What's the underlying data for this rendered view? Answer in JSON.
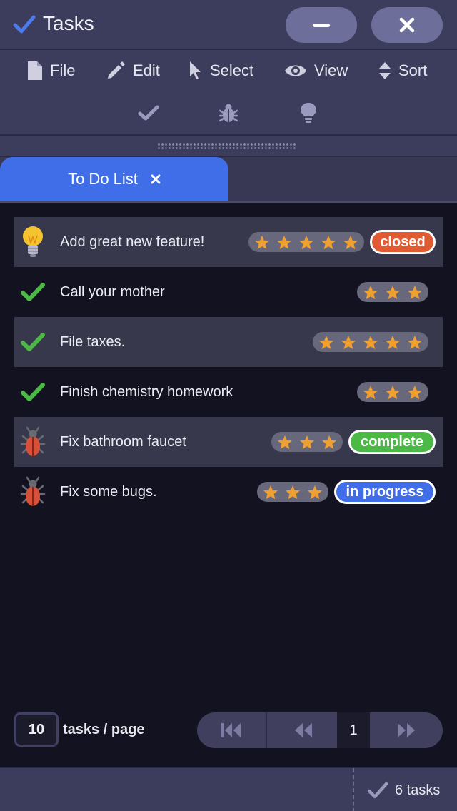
{
  "window": {
    "title": "Tasks",
    "title_icon": "check-icon",
    "minimize_icon": "minus-icon",
    "close_icon": "close-icon"
  },
  "menu": [
    {
      "label": "File",
      "icon": "file-icon"
    },
    {
      "label": "Edit",
      "icon": "pencil-icon"
    },
    {
      "label": "Select",
      "icon": "cursor-icon"
    },
    {
      "label": "View",
      "icon": "eye-icon"
    },
    {
      "label": "Sort",
      "icon": "sort-icon"
    }
  ],
  "toolbar": [
    {
      "icon": "check-icon"
    },
    {
      "icon": "bug-icon"
    },
    {
      "icon": "lightbulb-icon"
    }
  ],
  "tabs": [
    {
      "label": "To Do List",
      "close_icon": "close-icon"
    }
  ],
  "tasks": [
    {
      "icon": "lightbulb-icon",
      "text": "Add great new feature!",
      "stars": 5,
      "status": "closed",
      "status_color": "#e05a32"
    },
    {
      "icon": "check-icon",
      "text": "Call your mother",
      "stars": 3,
      "status": "",
      "status_color": ""
    },
    {
      "icon": "check-icon",
      "text": "File taxes.",
      "stars": 5,
      "status": "",
      "status_color": ""
    },
    {
      "icon": "check-icon",
      "text": "Finish chemistry homework",
      "stars": 3,
      "status": "",
      "status_color": ""
    },
    {
      "icon": "bug-icon",
      "text": "Fix bathroom faucet",
      "stars": 3,
      "status": "complete",
      "status_color": "#4cb846"
    },
    {
      "icon": "bug-icon",
      "text": "Fix some bugs.",
      "stars": 3,
      "status": "in progress",
      "status_color": "#3f6ee8"
    }
  ],
  "pagination": {
    "page_size": "10",
    "page_size_label": "tasks / page",
    "current_page": "1"
  },
  "status": {
    "count_text": "6 tasks"
  },
  "colors": {
    "accent": "#3f6ee8",
    "star": "#f0a030",
    "check": "#4cb846",
    "closed": "#e05a32"
  }
}
